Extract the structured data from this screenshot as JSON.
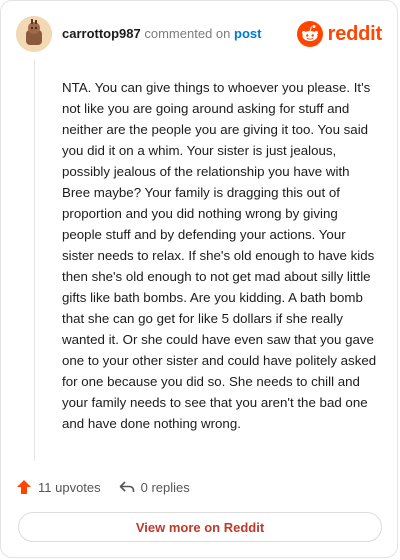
{
  "header": {
    "username": "carrottop987",
    "action": "commented on",
    "post_link": "post",
    "brand": "reddit"
  },
  "comment": {
    "text": "NTA. You can give things to whoever you please. It's not like you are going around asking for stuff and neither are the people you are giving it too. You said you did it on a whim. Your sister is just jealous, possibly jealous of the relationship you have with Bree maybe? Your family is dragging this out of proportion and you did nothing wrong by giving people stuff and by defending your actions. Your sister needs to relax. If she's old enough to have kids then she's old enough to not get mad about silly little gifts like bath bombs. Are you kidding. A bath bomb that she can go get for like 5 dollars if she really wanted it. Or she could have even saw that you gave one to your other sister and could have politely asked for one because you did so. She needs to chill and your family needs to see that you aren't the bad one and have done nothing wrong."
  },
  "footer": {
    "upvotes": "11 upvotes",
    "replies": "0 replies"
  },
  "view_more": "View more on Reddit",
  "colors": {
    "brand": "#ff4500",
    "link": "#0079d3",
    "view_more": "#c0392b"
  },
  "icons": {
    "upvote": "upvote-arrow-icon",
    "reply": "reply-arrow-icon",
    "brand": "reddit-snoo-icon",
    "avatar": "user-avatar"
  }
}
